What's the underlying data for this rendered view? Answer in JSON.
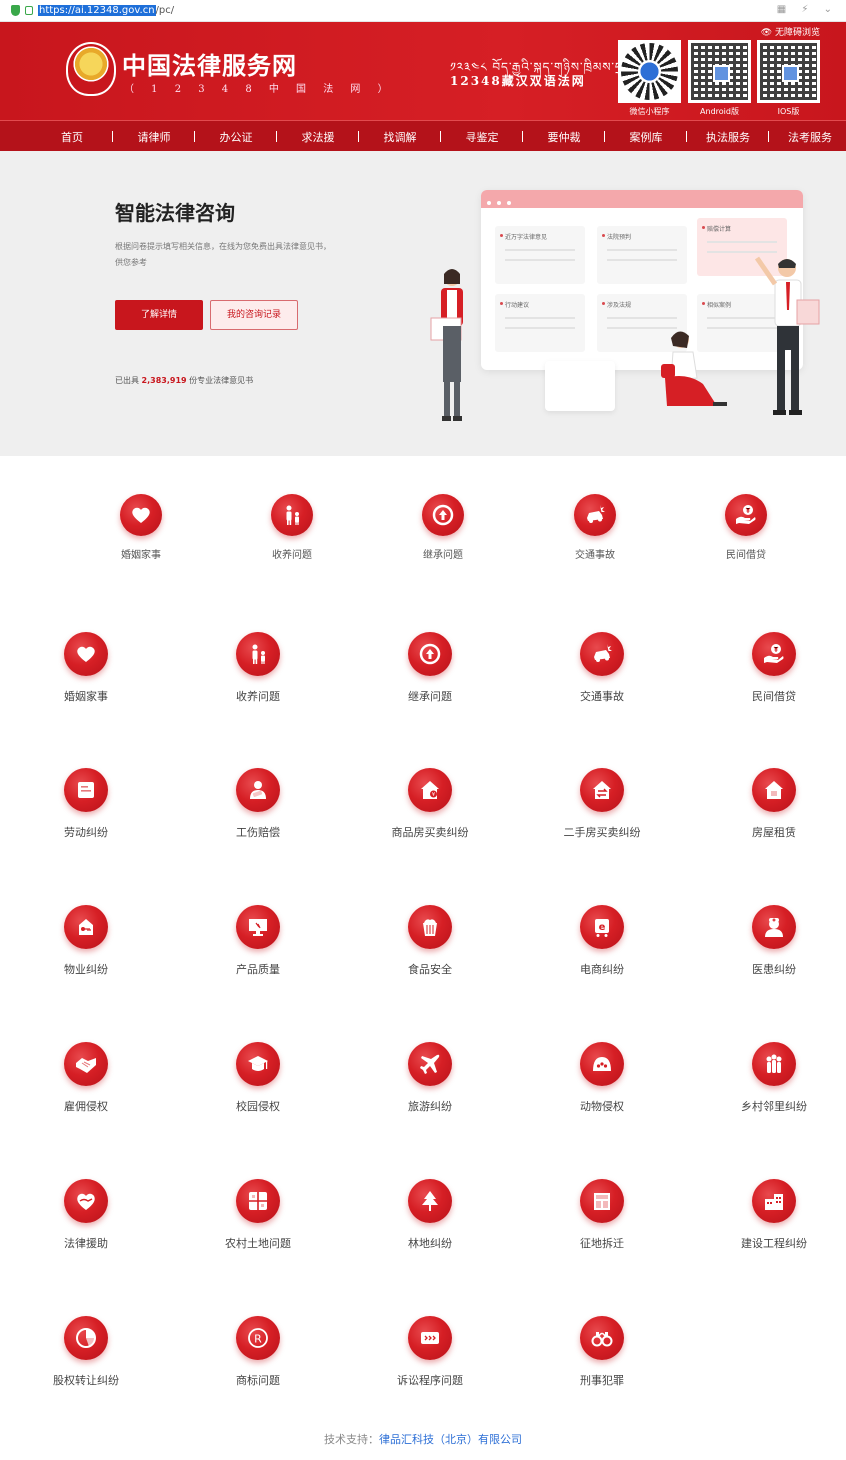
{
  "browser": {
    "url_selected": "https://ai.12348.gov.cn",
    "url_rest": "/pc/"
  },
  "header": {
    "site_title": "中国法律服务网",
    "site_subtitle": "（ 1 2 3 4 8 中 国 法 网 ）",
    "tibetan_line": "༡༢༣༤༨ བོད་རྒྱའི་སྐད་གཉིས་ཁྲིམས་དྲ",
    "bilingual_line": "12348藏汉双语法网",
    "accessibility": "无障碍浏览",
    "qr": [
      {
        "label": "微信小程序",
        "kind": "mini"
      },
      {
        "label": "Android版",
        "kind": "qr"
      },
      {
        "label": "IOS版",
        "kind": "qr"
      }
    ]
  },
  "nav": {
    "items": [
      "首页",
      "请律师",
      "办公证",
      "求法援",
      "找调解",
      "寻鉴定",
      "要仲裁",
      "案例库",
      "执法服务",
      "法考服务"
    ]
  },
  "hero": {
    "title": "智能法律咨询",
    "description": "根据问卷提示填写相关信息，在线为您免费出具法律意见书，供您参考",
    "primary_button": "了解详情",
    "secondary_button": "我的咨询记录",
    "stat_prefix": "已出具",
    "stat_number": "2,383,919",
    "stat_suffix": "份专业法律意见书",
    "illustration_cards": [
      "近万字法律意见",
      "法院预判",
      "赔偿计算",
      "行动建议",
      "涉及法规",
      "相似案例"
    ]
  },
  "featured_categories": [
    {
      "label": "婚姻家事",
      "icon": "heart-icon"
    },
    {
      "label": "收养问题",
      "icon": "parent-child-icon"
    },
    {
      "label": "继承问题",
      "icon": "inheritance-icon"
    },
    {
      "label": "交通事故",
      "icon": "car-accident-icon"
    },
    {
      "label": "民间借贷",
      "icon": "loan-icon"
    }
  ],
  "categories": [
    {
      "label": "婚姻家事",
      "icon": "heart-icon"
    },
    {
      "label": "收养问题",
      "icon": "parent-child-icon"
    },
    {
      "label": "继承问题",
      "icon": "inheritance-icon"
    },
    {
      "label": "交通事故",
      "icon": "car-accident-icon"
    },
    {
      "label": "民间借贷",
      "icon": "loan-icon"
    },
    {
      "label": "劳动纠纷",
      "icon": "labor-icon"
    },
    {
      "label": "工伤赔偿",
      "icon": "injury-icon"
    },
    {
      "label": "商品房买卖纠纷",
      "icon": "house-sale-icon"
    },
    {
      "label": "二手房买卖纠纷",
      "icon": "second-hand-house-icon"
    },
    {
      "label": "房屋租赁",
      "icon": "house-rent-icon"
    },
    {
      "label": "物业纠纷",
      "icon": "property-icon"
    },
    {
      "label": "产品质量",
      "icon": "product-quality-icon"
    },
    {
      "label": "食品安全",
      "icon": "food-safety-icon"
    },
    {
      "label": "电商纠纷",
      "icon": "ecommerce-icon"
    },
    {
      "label": "医患纠纷",
      "icon": "doctor-icon"
    },
    {
      "label": "雇佣侵权",
      "icon": "handshake-icon"
    },
    {
      "label": "校园侵权",
      "icon": "graduation-cap-icon"
    },
    {
      "label": "旅游纠纷",
      "icon": "airplane-icon"
    },
    {
      "label": "动物侵权",
      "icon": "animal-icon"
    },
    {
      "label": "乡村邻里纠纷",
      "icon": "neighbors-icon"
    },
    {
      "label": "法律援助",
      "icon": "legal-aid-icon"
    },
    {
      "label": "农村土地问题",
      "icon": "land-icon"
    },
    {
      "label": "林地纠纷",
      "icon": "tree-icon"
    },
    {
      "label": "征地拆迁",
      "icon": "demolition-icon"
    },
    {
      "label": "建设工程纠纷",
      "icon": "building-icon"
    },
    {
      "label": "股权转让纠纷",
      "icon": "pie-chart-icon"
    },
    {
      "label": "商标问题",
      "icon": "trademark-icon"
    },
    {
      "label": "诉讼程序问题",
      "icon": "litigation-icon"
    },
    {
      "label": "刑事犯罪",
      "icon": "handcuffs-icon"
    }
  ],
  "footer": {
    "prefix": "技术支持：",
    "company": "律品汇科技（北京）有限公司"
  },
  "colors": {
    "brand_red": "#c8161d",
    "nav_red": "#b4121a",
    "hero_bg": "#efefef",
    "link_blue": "#2d6fd6"
  }
}
